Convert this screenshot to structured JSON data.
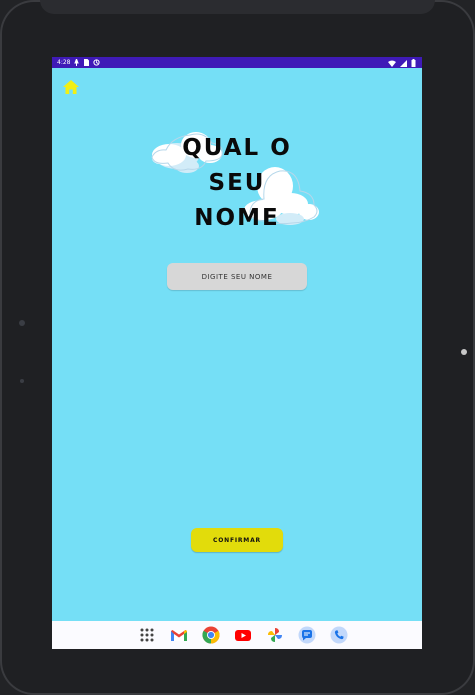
{
  "status_bar": {
    "time": "4:28",
    "icons": [
      "signal-indicator-icon",
      "sd-card-icon",
      "sync-icon",
      "wifi-icon",
      "cell-signal-icon",
      "battery-icon"
    ]
  },
  "app": {
    "home_icon": "home-icon",
    "title_lines": [
      "QUAL O",
      "SEU",
      "NOME"
    ],
    "name_input": {
      "placeholder": "DIGITE SEU NOME",
      "value": ""
    },
    "confirm_label": "CONFIRMAR",
    "colors": {
      "background": "#75dff6",
      "status_bar": "#3f1ab7",
      "home_icon": "#f1ef14",
      "input_background": "#d7d7d7",
      "button_background": "#e2dc0b"
    }
  },
  "dock": {
    "apps": [
      {
        "name": "app-drawer-icon"
      },
      {
        "name": "gmail-icon"
      },
      {
        "name": "chrome-icon"
      },
      {
        "name": "youtube-icon"
      },
      {
        "name": "photos-icon"
      },
      {
        "name": "messages-icon"
      },
      {
        "name": "phone-icon"
      }
    ]
  }
}
